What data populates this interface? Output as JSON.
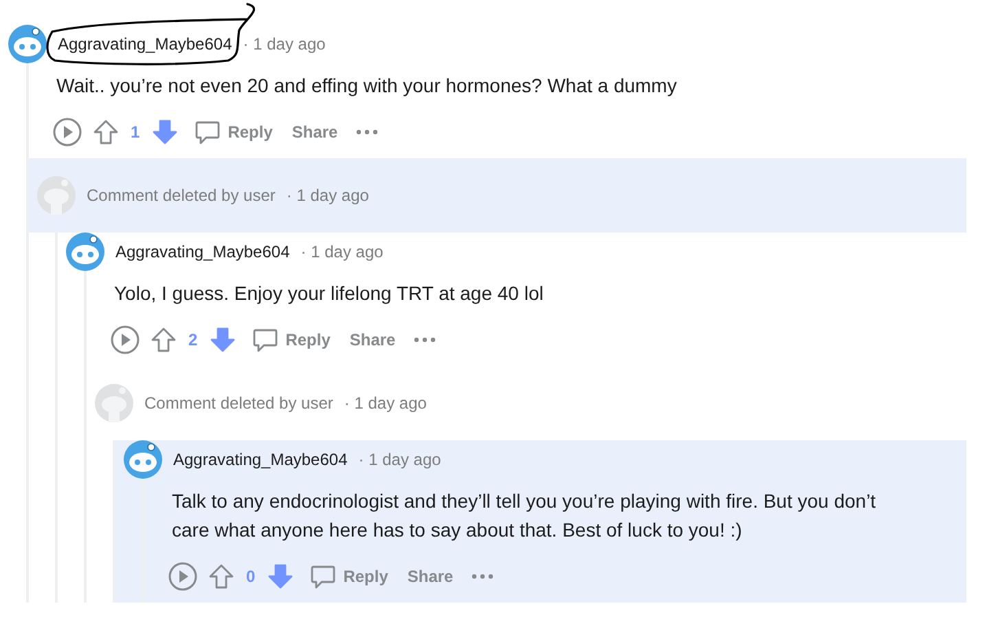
{
  "comments": [
    {
      "kind": "user",
      "author": "Aggravating_Maybe604",
      "time": "· 1 day ago",
      "highlighted": false,
      "body": "Wait.. you’re not even 20 and effing with your hormones? What a dummy",
      "score": "1",
      "downvoted": true,
      "actions": [
        "Reply",
        "Share"
      ],
      "children": [
        {
          "kind": "deleted",
          "text": "Comment deleted by user",
          "time": "· 1 day ago",
          "highlighted": true,
          "children": [
            {
              "kind": "user",
              "author": "Aggravating_Maybe604",
              "time": "· 1 day ago",
              "highlighted": false,
              "body": "Yolo, I guess. Enjoy your lifelong TRT at age 40 lol",
              "score": "2",
              "downvoted": true,
              "actions": [
                "Reply",
                "Share"
              ],
              "children": [
                {
                  "kind": "deleted",
                  "text": "Comment deleted by user",
                  "time": "· 1 day ago",
                  "highlighted": false,
                  "children": [
                    {
                      "kind": "user",
                      "author": "Aggravating_Maybe604",
                      "time": "· 1 day ago",
                      "highlighted": true,
                      "body": "Talk to any endocrinologist and they’ll tell you you’re playing with fire. But you don’t care what anyone here has to say about that. Best of luck to you! :)",
                      "score": "0",
                      "downvoted": true,
                      "actions": [
                        "Reply",
                        "Share"
                      ]
                    }
                  ]
                }
              ]
            }
          ]
        }
      ]
    }
  ],
  "annotation": {
    "kind": "scribble"
  }
}
